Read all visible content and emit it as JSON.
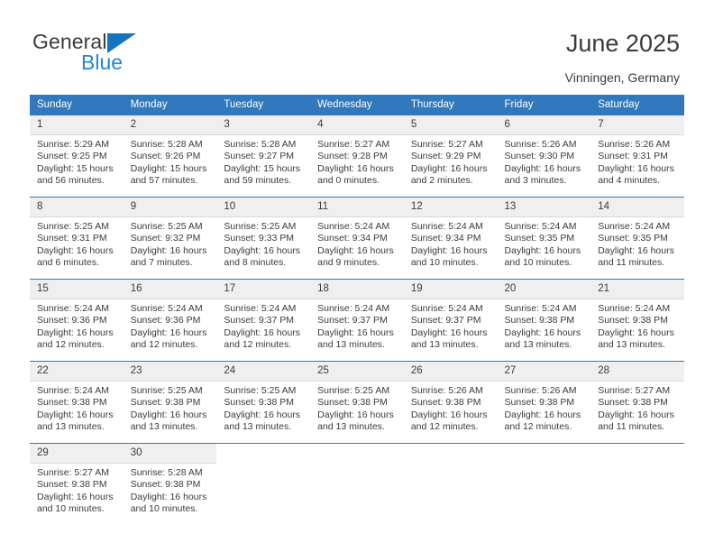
{
  "brand": {
    "name_top": "General",
    "name_bottom": "Blue",
    "triangle_color": "#1574bf"
  },
  "header": {
    "title": "June 2025",
    "location": "Vinningen, Germany"
  },
  "theme": {
    "header_bg": "#3178bd",
    "daynum_bg": "#efefef",
    "text": "#3b3b3b",
    "rule": "#3178bd"
  },
  "weekdays": [
    "Sunday",
    "Monday",
    "Tuesday",
    "Wednesday",
    "Thursday",
    "Friday",
    "Saturday"
  ],
  "weeks": [
    [
      {
        "day": "1",
        "sunrise": "Sunrise: 5:29 AM",
        "sunset": "Sunset: 9:25 PM",
        "daylight": "Daylight: 15 hours and 56 minutes."
      },
      {
        "day": "2",
        "sunrise": "Sunrise: 5:28 AM",
        "sunset": "Sunset: 9:26 PM",
        "daylight": "Daylight: 15 hours and 57 minutes."
      },
      {
        "day": "3",
        "sunrise": "Sunrise: 5:28 AM",
        "sunset": "Sunset: 9:27 PM",
        "daylight": "Daylight: 15 hours and 59 minutes."
      },
      {
        "day": "4",
        "sunrise": "Sunrise: 5:27 AM",
        "sunset": "Sunset: 9:28 PM",
        "daylight": "Daylight: 16 hours and 0 minutes."
      },
      {
        "day": "5",
        "sunrise": "Sunrise: 5:27 AM",
        "sunset": "Sunset: 9:29 PM",
        "daylight": "Daylight: 16 hours and 2 minutes."
      },
      {
        "day": "6",
        "sunrise": "Sunrise: 5:26 AM",
        "sunset": "Sunset: 9:30 PM",
        "daylight": "Daylight: 16 hours and 3 minutes."
      },
      {
        "day": "7",
        "sunrise": "Sunrise: 5:26 AM",
        "sunset": "Sunset: 9:31 PM",
        "daylight": "Daylight: 16 hours and 4 minutes."
      }
    ],
    [
      {
        "day": "8",
        "sunrise": "Sunrise: 5:25 AM",
        "sunset": "Sunset: 9:31 PM",
        "daylight": "Daylight: 16 hours and 6 minutes."
      },
      {
        "day": "9",
        "sunrise": "Sunrise: 5:25 AM",
        "sunset": "Sunset: 9:32 PM",
        "daylight": "Daylight: 16 hours and 7 minutes."
      },
      {
        "day": "10",
        "sunrise": "Sunrise: 5:25 AM",
        "sunset": "Sunset: 9:33 PM",
        "daylight": "Daylight: 16 hours and 8 minutes."
      },
      {
        "day": "11",
        "sunrise": "Sunrise: 5:24 AM",
        "sunset": "Sunset: 9:34 PM",
        "daylight": "Daylight: 16 hours and 9 minutes."
      },
      {
        "day": "12",
        "sunrise": "Sunrise: 5:24 AM",
        "sunset": "Sunset: 9:34 PM",
        "daylight": "Daylight: 16 hours and 10 minutes."
      },
      {
        "day": "13",
        "sunrise": "Sunrise: 5:24 AM",
        "sunset": "Sunset: 9:35 PM",
        "daylight": "Daylight: 16 hours and 10 minutes."
      },
      {
        "day": "14",
        "sunrise": "Sunrise: 5:24 AM",
        "sunset": "Sunset: 9:35 PM",
        "daylight": "Daylight: 16 hours and 11 minutes."
      }
    ],
    [
      {
        "day": "15",
        "sunrise": "Sunrise: 5:24 AM",
        "sunset": "Sunset: 9:36 PM",
        "daylight": "Daylight: 16 hours and 12 minutes."
      },
      {
        "day": "16",
        "sunrise": "Sunrise: 5:24 AM",
        "sunset": "Sunset: 9:36 PM",
        "daylight": "Daylight: 16 hours and 12 minutes."
      },
      {
        "day": "17",
        "sunrise": "Sunrise: 5:24 AM",
        "sunset": "Sunset: 9:37 PM",
        "daylight": "Daylight: 16 hours and 12 minutes."
      },
      {
        "day": "18",
        "sunrise": "Sunrise: 5:24 AM",
        "sunset": "Sunset: 9:37 PM",
        "daylight": "Daylight: 16 hours and 13 minutes."
      },
      {
        "day": "19",
        "sunrise": "Sunrise: 5:24 AM",
        "sunset": "Sunset: 9:37 PM",
        "daylight": "Daylight: 16 hours and 13 minutes."
      },
      {
        "day": "20",
        "sunrise": "Sunrise: 5:24 AM",
        "sunset": "Sunset: 9:38 PM",
        "daylight": "Daylight: 16 hours and 13 minutes."
      },
      {
        "day": "21",
        "sunrise": "Sunrise: 5:24 AM",
        "sunset": "Sunset: 9:38 PM",
        "daylight": "Daylight: 16 hours and 13 minutes."
      }
    ],
    [
      {
        "day": "22",
        "sunrise": "Sunrise: 5:24 AM",
        "sunset": "Sunset: 9:38 PM",
        "daylight": "Daylight: 16 hours and 13 minutes."
      },
      {
        "day": "23",
        "sunrise": "Sunrise: 5:25 AM",
        "sunset": "Sunset: 9:38 PM",
        "daylight": "Daylight: 16 hours and 13 minutes."
      },
      {
        "day": "24",
        "sunrise": "Sunrise: 5:25 AM",
        "sunset": "Sunset: 9:38 PM",
        "daylight": "Daylight: 16 hours and 13 minutes."
      },
      {
        "day": "25",
        "sunrise": "Sunrise: 5:25 AM",
        "sunset": "Sunset: 9:38 PM",
        "daylight": "Daylight: 16 hours and 13 minutes."
      },
      {
        "day": "26",
        "sunrise": "Sunrise: 5:26 AM",
        "sunset": "Sunset: 9:38 PM",
        "daylight": "Daylight: 16 hours and 12 minutes."
      },
      {
        "day": "27",
        "sunrise": "Sunrise: 5:26 AM",
        "sunset": "Sunset: 9:38 PM",
        "daylight": "Daylight: 16 hours and 12 minutes."
      },
      {
        "day": "28",
        "sunrise": "Sunrise: 5:27 AM",
        "sunset": "Sunset: 9:38 PM",
        "daylight": "Daylight: 16 hours and 11 minutes."
      }
    ],
    [
      {
        "day": "29",
        "sunrise": "Sunrise: 5:27 AM",
        "sunset": "Sunset: 9:38 PM",
        "daylight": "Daylight: 16 hours and 10 minutes."
      },
      {
        "day": "30",
        "sunrise": "Sunrise: 5:28 AM",
        "sunset": "Sunset: 9:38 PM",
        "daylight": "Daylight: 16 hours and 10 minutes."
      },
      {
        "day": "",
        "sunrise": "",
        "sunset": "",
        "daylight": ""
      },
      {
        "day": "",
        "sunrise": "",
        "sunset": "",
        "daylight": ""
      },
      {
        "day": "",
        "sunrise": "",
        "sunset": "",
        "daylight": ""
      },
      {
        "day": "",
        "sunrise": "",
        "sunset": "",
        "daylight": ""
      },
      {
        "day": "",
        "sunrise": "",
        "sunset": "",
        "daylight": ""
      }
    ]
  ]
}
